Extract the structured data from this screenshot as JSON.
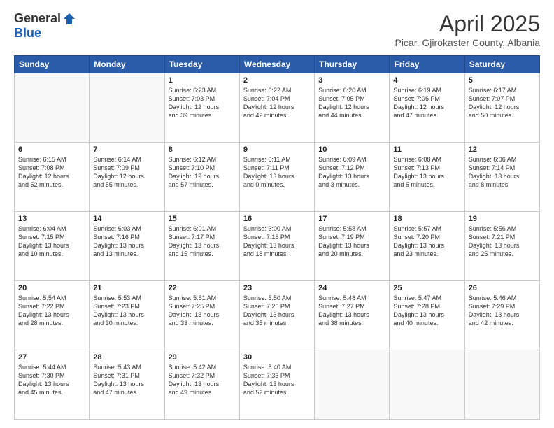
{
  "header": {
    "logo": {
      "general": "General",
      "blue": "Blue"
    },
    "title": "April 2025",
    "location": "Picar, Gjirokaster County, Albania"
  },
  "calendar": {
    "days_of_week": [
      "Sunday",
      "Monday",
      "Tuesday",
      "Wednesday",
      "Thursday",
      "Friday",
      "Saturday"
    ],
    "weeks": [
      [
        {
          "day": "",
          "info": ""
        },
        {
          "day": "",
          "info": ""
        },
        {
          "day": "1",
          "info": "Sunrise: 6:23 AM\nSunset: 7:03 PM\nDaylight: 12 hours\nand 39 minutes."
        },
        {
          "day": "2",
          "info": "Sunrise: 6:22 AM\nSunset: 7:04 PM\nDaylight: 12 hours\nand 42 minutes."
        },
        {
          "day": "3",
          "info": "Sunrise: 6:20 AM\nSunset: 7:05 PM\nDaylight: 12 hours\nand 44 minutes."
        },
        {
          "day": "4",
          "info": "Sunrise: 6:19 AM\nSunset: 7:06 PM\nDaylight: 12 hours\nand 47 minutes."
        },
        {
          "day": "5",
          "info": "Sunrise: 6:17 AM\nSunset: 7:07 PM\nDaylight: 12 hours\nand 50 minutes."
        }
      ],
      [
        {
          "day": "6",
          "info": "Sunrise: 6:15 AM\nSunset: 7:08 PM\nDaylight: 12 hours\nand 52 minutes."
        },
        {
          "day": "7",
          "info": "Sunrise: 6:14 AM\nSunset: 7:09 PM\nDaylight: 12 hours\nand 55 minutes."
        },
        {
          "day": "8",
          "info": "Sunrise: 6:12 AM\nSunset: 7:10 PM\nDaylight: 12 hours\nand 57 minutes."
        },
        {
          "day": "9",
          "info": "Sunrise: 6:11 AM\nSunset: 7:11 PM\nDaylight: 13 hours\nand 0 minutes."
        },
        {
          "day": "10",
          "info": "Sunrise: 6:09 AM\nSunset: 7:12 PM\nDaylight: 13 hours\nand 3 minutes."
        },
        {
          "day": "11",
          "info": "Sunrise: 6:08 AM\nSunset: 7:13 PM\nDaylight: 13 hours\nand 5 minutes."
        },
        {
          "day": "12",
          "info": "Sunrise: 6:06 AM\nSunset: 7:14 PM\nDaylight: 13 hours\nand 8 minutes."
        }
      ],
      [
        {
          "day": "13",
          "info": "Sunrise: 6:04 AM\nSunset: 7:15 PM\nDaylight: 13 hours\nand 10 minutes."
        },
        {
          "day": "14",
          "info": "Sunrise: 6:03 AM\nSunset: 7:16 PM\nDaylight: 13 hours\nand 13 minutes."
        },
        {
          "day": "15",
          "info": "Sunrise: 6:01 AM\nSunset: 7:17 PM\nDaylight: 13 hours\nand 15 minutes."
        },
        {
          "day": "16",
          "info": "Sunrise: 6:00 AM\nSunset: 7:18 PM\nDaylight: 13 hours\nand 18 minutes."
        },
        {
          "day": "17",
          "info": "Sunrise: 5:58 AM\nSunset: 7:19 PM\nDaylight: 13 hours\nand 20 minutes."
        },
        {
          "day": "18",
          "info": "Sunrise: 5:57 AM\nSunset: 7:20 PM\nDaylight: 13 hours\nand 23 minutes."
        },
        {
          "day": "19",
          "info": "Sunrise: 5:56 AM\nSunset: 7:21 PM\nDaylight: 13 hours\nand 25 minutes."
        }
      ],
      [
        {
          "day": "20",
          "info": "Sunrise: 5:54 AM\nSunset: 7:22 PM\nDaylight: 13 hours\nand 28 minutes."
        },
        {
          "day": "21",
          "info": "Sunrise: 5:53 AM\nSunset: 7:23 PM\nDaylight: 13 hours\nand 30 minutes."
        },
        {
          "day": "22",
          "info": "Sunrise: 5:51 AM\nSunset: 7:25 PM\nDaylight: 13 hours\nand 33 minutes."
        },
        {
          "day": "23",
          "info": "Sunrise: 5:50 AM\nSunset: 7:26 PM\nDaylight: 13 hours\nand 35 minutes."
        },
        {
          "day": "24",
          "info": "Sunrise: 5:48 AM\nSunset: 7:27 PM\nDaylight: 13 hours\nand 38 minutes."
        },
        {
          "day": "25",
          "info": "Sunrise: 5:47 AM\nSunset: 7:28 PM\nDaylight: 13 hours\nand 40 minutes."
        },
        {
          "day": "26",
          "info": "Sunrise: 5:46 AM\nSunset: 7:29 PM\nDaylight: 13 hours\nand 42 minutes."
        }
      ],
      [
        {
          "day": "27",
          "info": "Sunrise: 5:44 AM\nSunset: 7:30 PM\nDaylight: 13 hours\nand 45 minutes."
        },
        {
          "day": "28",
          "info": "Sunrise: 5:43 AM\nSunset: 7:31 PM\nDaylight: 13 hours\nand 47 minutes."
        },
        {
          "day": "29",
          "info": "Sunrise: 5:42 AM\nSunset: 7:32 PM\nDaylight: 13 hours\nand 49 minutes."
        },
        {
          "day": "30",
          "info": "Sunrise: 5:40 AM\nSunset: 7:33 PM\nDaylight: 13 hours\nand 52 minutes."
        },
        {
          "day": "",
          "info": ""
        },
        {
          "day": "",
          "info": ""
        },
        {
          "day": "",
          "info": ""
        }
      ]
    ]
  }
}
